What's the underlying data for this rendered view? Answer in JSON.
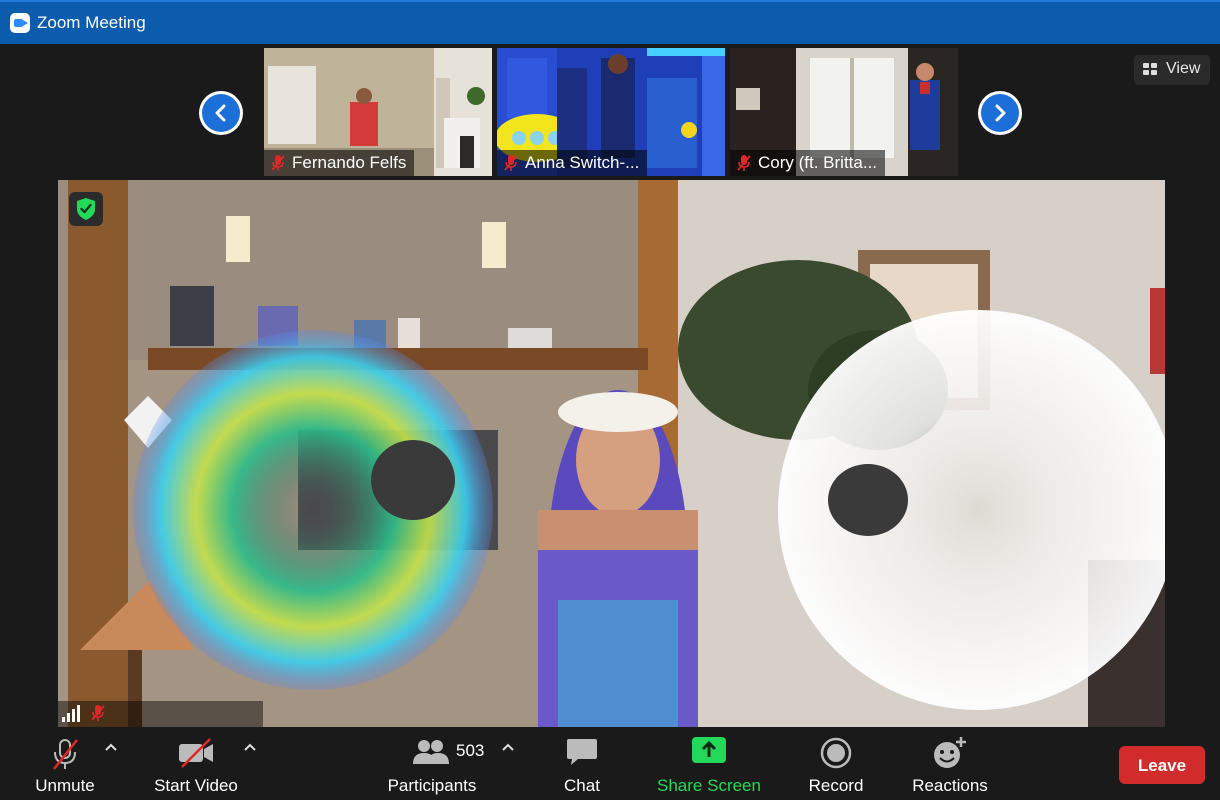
{
  "window": {
    "title": "Zoom Meeting"
  },
  "view_button": {
    "label": "View",
    "icon": "grid-icon"
  },
  "thumbnails": [
    {
      "name": "Fernando Felfs",
      "muted": true
    },
    {
      "name": "Anna Switch-...",
      "muted": true
    },
    {
      "name": "Cory (ft. Britta...",
      "muted": true
    }
  ],
  "toolbar": {
    "unmute_label": "Unmute",
    "start_video_label": "Start Video",
    "participants_label": "Participants",
    "participants_count": "503",
    "chat_label": "Chat",
    "share_screen_label": "Share Screen",
    "record_label": "Record",
    "reactions_label": "Reactions",
    "leave_label": "Leave"
  },
  "colors": {
    "title_bar": "#0b5cad",
    "share_screen": "#23d959",
    "leave": "#d12b2b",
    "nav_arrow": "#1c6fd8",
    "shield": "#23d959"
  }
}
